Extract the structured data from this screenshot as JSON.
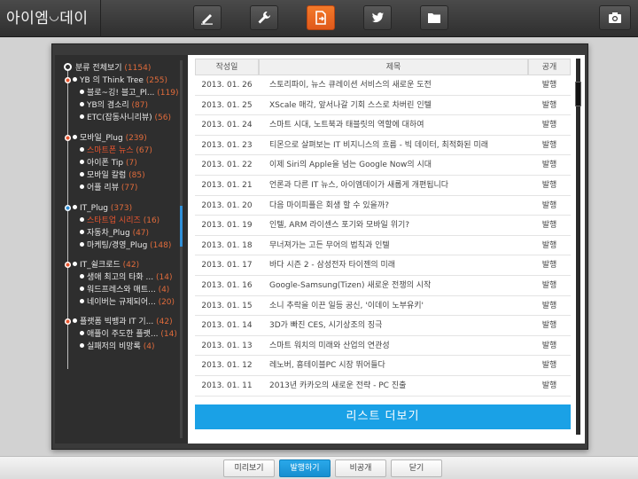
{
  "app": {
    "logo": "아이엠",
    "logo_suffix": "데이"
  },
  "toolbar": {
    "buttons": [
      {
        "icon": "pen-icon"
      },
      {
        "icon": "wrench-icon"
      },
      {
        "icon": "export-icon",
        "active": true
      },
      {
        "icon": "twitter-icon"
      },
      {
        "icon": "folder-icon"
      }
    ],
    "camera_icon": "camera-icon"
  },
  "sidebar": {
    "items": [
      {
        "label": "분류 전체보기",
        "count": "(1154)"
      },
      {
        "label": "YB 의 Think Tree",
        "count": "(255)"
      },
      {
        "label": "블로~깅! 블고_Pl...",
        "count": "(119)"
      },
      {
        "label": "YB의 겸소리",
        "count": "(87)"
      },
      {
        "label": "ETC(잡동사니리뷰)",
        "count": "(56)"
      },
      {
        "label": "모바일_Plug",
        "count": "(239)"
      },
      {
        "label": "스마트폰 뉴스",
        "count": "(67)"
      },
      {
        "label": "아이폰 Tip",
        "count": "(7)"
      },
      {
        "label": "모바일 칼럼",
        "count": "(85)"
      },
      {
        "label": "어플 리뷰",
        "count": "(77)"
      },
      {
        "label": "IT_Plug",
        "count": "(373)"
      },
      {
        "label": "스타트업 시리즈",
        "count": "(16)"
      },
      {
        "label": "자동차_Plug",
        "count": "(47)"
      },
      {
        "label": "마케팅/경영_Plug",
        "count": "(148)"
      },
      {
        "label": "IT_쉴크로드",
        "count": "(42)"
      },
      {
        "label": "생애 최고의 타화 ...",
        "count": "(14)"
      },
      {
        "label": "워드프레스와 매트...",
        "count": "(4)"
      },
      {
        "label": "네이버는 규제되어...",
        "count": "(20)"
      },
      {
        "label": "플랫폼 빅뱅과 IT 기...",
        "count": "(42)"
      },
      {
        "label": "애플이 주도한 플랫...",
        "count": "(14)"
      },
      {
        "label": "실패저의 비망록",
        "count": "(4)"
      }
    ]
  },
  "table": {
    "headers": [
      "작성일",
      "제목",
      "공개"
    ],
    "rows": [
      {
        "date": "2013. 01. 26",
        "title": "스토리파이, 뉴스 큐레이션 서비스의 새로운 도전",
        "status": "발행"
      },
      {
        "date": "2013. 01. 25",
        "title": "XScale 매각, 앞서나갈 기회 스스로 차버린 인텔",
        "status": "발행"
      },
      {
        "date": "2013. 01. 24",
        "title": "스마트 시대, 노트북과 태블릿의 역할에 대하여",
        "status": "발행"
      },
      {
        "date": "2013. 01. 23",
        "title": "티몬으로 살펴보는 IT 비지니스의 흐름 - 빅 데이터, 최적화된 미래",
        "status": "발행"
      },
      {
        "date": "2013. 01. 22",
        "title": "이제 Siri의 Apple을 넘는 Google Now의 시대",
        "status": "발행"
      },
      {
        "date": "2013. 01. 21",
        "title": "언론과 다른 IT 뉴스, 아이엠데이가 새롭게 개편됩니다",
        "status": "발행"
      },
      {
        "date": "2013. 01. 20",
        "title": "다음 마이피플은 회생 할 수 있을까?",
        "status": "발행"
      },
      {
        "date": "2013. 01. 19",
        "title": "인텔, ARM 라이센스 포기와 모바일 위기?",
        "status": "발행"
      },
      {
        "date": "2013. 01. 18",
        "title": "무너져가는 고든 무어의 법칙과 인텔",
        "status": "발행"
      },
      {
        "date": "2013. 01. 17",
        "title": "바다 시즌 2 - 삼성전자 타이젠의 미래",
        "status": "발행"
      },
      {
        "date": "2013. 01. 16",
        "title": "Google-Samsung(Tizen) 새로운 전쟁의 시작",
        "status": "발행"
      },
      {
        "date": "2013. 01. 15",
        "title": "소니 추락을 이끈 일등 공신, '이데이 노부유키'",
        "status": "발행"
      },
      {
        "date": "2013. 01. 14",
        "title": "3D가 빠진 CES, 시기상조의 징극",
        "status": "발행"
      },
      {
        "date": "2013. 01. 13",
        "title": "스마트 워치의 미래와 산업의 연관성",
        "status": "발행"
      },
      {
        "date": "2013. 01. 12",
        "title": "레노버, 흥테이블PC 시장 뛰어들다",
        "status": "발행"
      },
      {
        "date": "2013. 01. 11",
        "title": "2013년 카카오의 새로운 전략 - PC 진출",
        "status": "발행"
      }
    ],
    "more_label": "리스트 더보기"
  },
  "bottom": {
    "preview": "미리보기",
    "publish": "발행하기",
    "private": "비공개",
    "close": "닫기"
  },
  "colors": {
    "accent_orange": "#e0591b",
    "accent_blue": "#1aa1e6"
  }
}
